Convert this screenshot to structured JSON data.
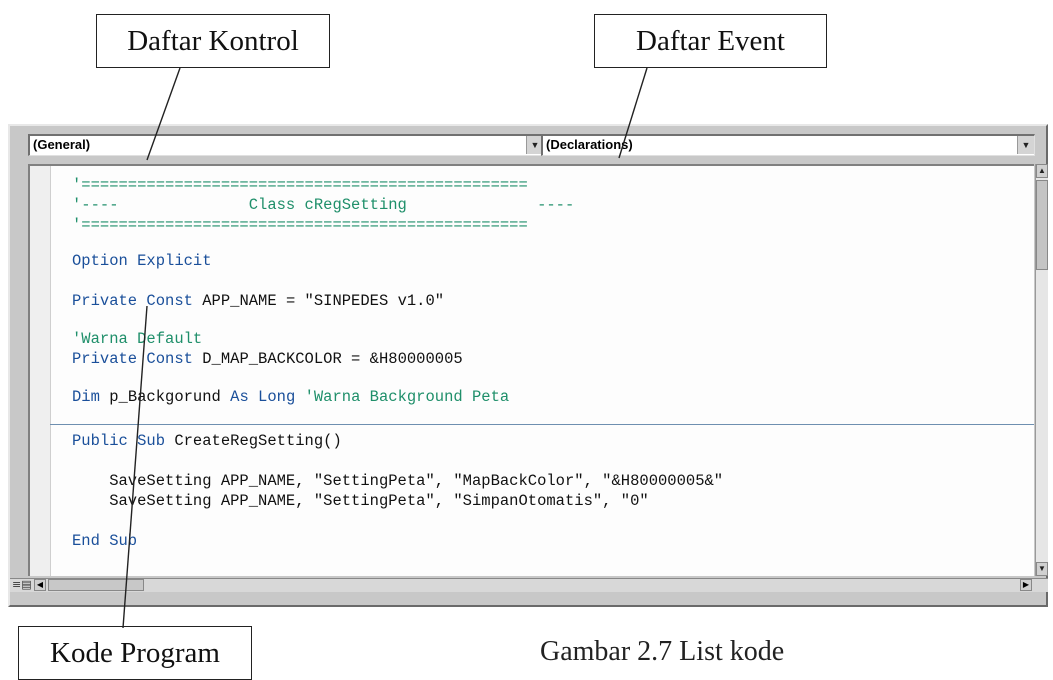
{
  "callouts": {
    "kontrol": "Daftar Kontrol",
    "event": "Daftar Event",
    "kode": "Kode Program"
  },
  "caption": "Gambar 2.7 List kode",
  "editor": {
    "object_combo": "(General)",
    "procedure_combo": "(Declarations)",
    "code": [
      {
        "parts": [
          {
            "t": "'================================================",
            "c": "cm"
          }
        ]
      },
      {
        "parts": [
          {
            "t": "'----              Class cRegSetting              ----",
            "c": "cm"
          }
        ]
      },
      {
        "parts": [
          {
            "t": "'================================================",
            "c": "cm"
          }
        ]
      },
      {
        "parts": [
          {
            "t": "",
            "c": "tx"
          }
        ]
      },
      {
        "parts": [
          {
            "t": "Option Explicit",
            "c": "kw"
          }
        ]
      },
      {
        "parts": [
          {
            "t": "",
            "c": "tx"
          }
        ]
      },
      {
        "parts": [
          {
            "t": "Private Const ",
            "c": "kw"
          },
          {
            "t": "APP_NAME = \"SINPEDES v1.0\"",
            "c": "tx"
          }
        ]
      },
      {
        "parts": [
          {
            "t": "",
            "c": "tx"
          }
        ]
      },
      {
        "parts": [
          {
            "t": "'Warna Default",
            "c": "cm"
          }
        ]
      },
      {
        "parts": [
          {
            "t": "Private Const ",
            "c": "kw"
          },
          {
            "t": "D_MAP_BACKCOLOR = &H80000005",
            "c": "tx"
          }
        ]
      },
      {
        "parts": [
          {
            "t": "",
            "c": "tx"
          }
        ]
      },
      {
        "parts": [
          {
            "t": "Dim ",
            "c": "kw"
          },
          {
            "t": "p_Backgorund ",
            "c": "tx"
          },
          {
            "t": "As Long ",
            "c": "kw"
          },
          {
            "t": "'Warna Background Peta",
            "c": "cm"
          }
        ]
      },
      {
        "parts": [
          {
            "t": "",
            "c": "tx"
          }
        ]
      },
      {
        "parts": [
          {
            "t": "Public Sub ",
            "c": "kw"
          },
          {
            "t": "CreateRegSetting()",
            "c": "tx"
          }
        ]
      },
      {
        "parts": [
          {
            "t": "",
            "c": "tx"
          }
        ]
      },
      {
        "parts": [
          {
            "t": "    SaveSetting APP_NAME, \"SettingPeta\", \"MapBackColor\", \"&H80000005&\"",
            "c": "tx"
          }
        ]
      },
      {
        "parts": [
          {
            "t": "    SaveSetting APP_NAME, \"SettingPeta\", \"SimpanOtomatis\", \"0\"",
            "c": "tx"
          }
        ]
      },
      {
        "parts": [
          {
            "t": "",
            "c": "tx"
          }
        ]
      },
      {
        "parts": [
          {
            "t": "End Sub",
            "c": "kw"
          }
        ]
      }
    ]
  },
  "icons": {
    "combo_dropdown": "chevron-down-icon",
    "scroll_up": "arrow-up-icon",
    "scroll_down": "arrow-down-icon",
    "scroll_left": "arrow-left-icon",
    "scroll_right": "arrow-right-icon",
    "split_view": "split-view-icon"
  }
}
